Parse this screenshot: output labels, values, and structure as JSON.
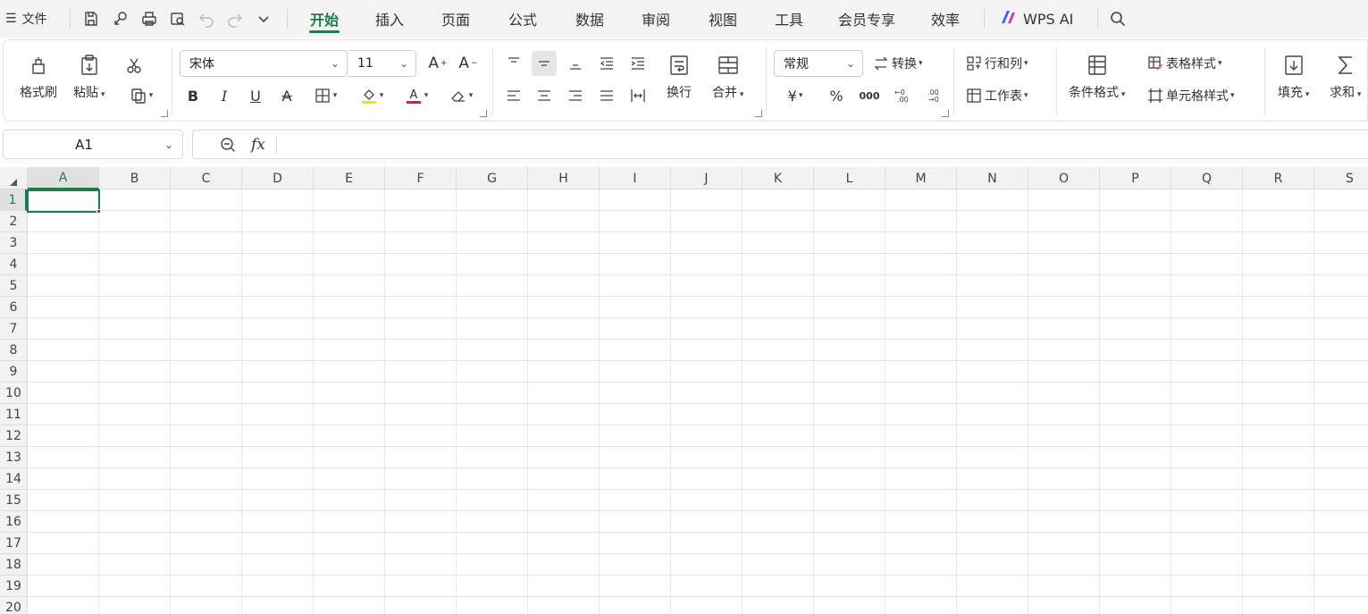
{
  "menu": {
    "file_label": "文件",
    "tabs": [
      "开始",
      "插入",
      "页面",
      "公式",
      "数据",
      "审阅",
      "视图",
      "工具",
      "会员专享",
      "效率"
    ],
    "active_tab": "开始",
    "ai_label": "WPS AI"
  },
  "ribbon": {
    "format_painter": "格式刷",
    "paste": "粘贴",
    "font_name": "宋体",
    "font_size": "11",
    "wrap": "换行",
    "merge": "合并",
    "number_format": "常规",
    "convert": "转换",
    "rows_cols": "行和列",
    "worksheet": "工作表",
    "conditional_format": "条件格式",
    "table_style": "表格样式",
    "cell_style": "单元格样式",
    "fill": "填充",
    "sum": "求和",
    "currency_symbol": "¥",
    "percent_symbol": "%",
    "thousands_symbol": "000"
  },
  "formula_bar": {
    "name_box": "A1",
    "fx": "fx",
    "formula": ""
  },
  "sheet": {
    "columns": [
      "A",
      "B",
      "C",
      "D",
      "E",
      "F",
      "G",
      "H",
      "I",
      "J",
      "K",
      "L",
      "M",
      "N",
      "O",
      "P",
      "Q",
      "R",
      "S"
    ],
    "rows": [
      "1",
      "2",
      "3",
      "4",
      "5",
      "6",
      "7",
      "8",
      "9",
      "10",
      "11",
      "12",
      "13",
      "14",
      "15",
      "16",
      "17",
      "18",
      "19",
      "20"
    ],
    "active_cell": "A1"
  },
  "colors": {
    "accent": "#1e7c4a",
    "highlight_yellow": "#f5e600",
    "font_red": "#e02020"
  }
}
